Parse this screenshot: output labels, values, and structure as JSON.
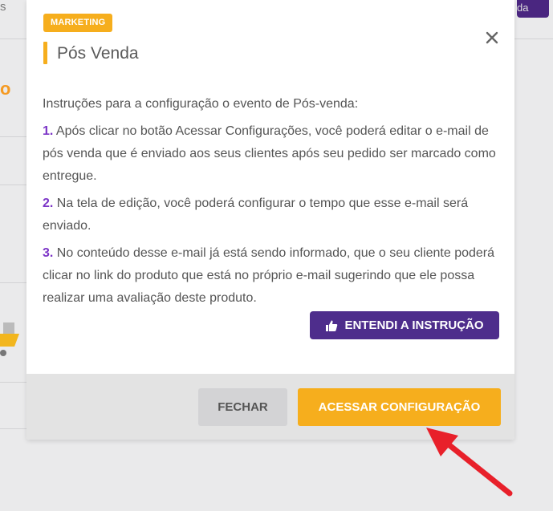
{
  "background": {
    "partial_left_text": "s",
    "partial_logo_letter": "o",
    "partial_right_button_text": "da"
  },
  "modal": {
    "badge": "MARKETING",
    "title": "Pós Venda",
    "close_icon": "close-icon",
    "intro": "Instruções para a configuração o evento de Pós-venda:",
    "items": [
      {
        "num": "1.",
        "text": "Após clicar no botão Acessar Configurações, você poderá editar o e-mail de pós venda que é enviado aos seus clientes após seu pedido ser marcado como entregue."
      },
      {
        "num": "2.",
        "text": "Na tela de edição, você poderá configurar o tempo que esse e-mail será enviado."
      },
      {
        "num": "3.",
        "text": "No conteúdo desse e-mail já está sendo informado, que o seu cliente poderá clicar no link do produto que está no próprio e-mail sugerindo que ele possa realizar uma avaliação deste produto."
      }
    ],
    "ack_button": "ENTENDI A INSTRUÇÃO",
    "ack_icon": "thumbs-up-icon",
    "footer": {
      "close_button": "FECHAR",
      "access_button": "ACESSAR CONFIGURAÇÃO"
    }
  },
  "annotation": {
    "arrow_icon": "red-arrow-icon",
    "color": "#e8202a"
  },
  "colors": {
    "accent_orange": "#f6ae1d",
    "accent_purple": "#4e2d8c",
    "number_purple": "#7c35c7"
  }
}
